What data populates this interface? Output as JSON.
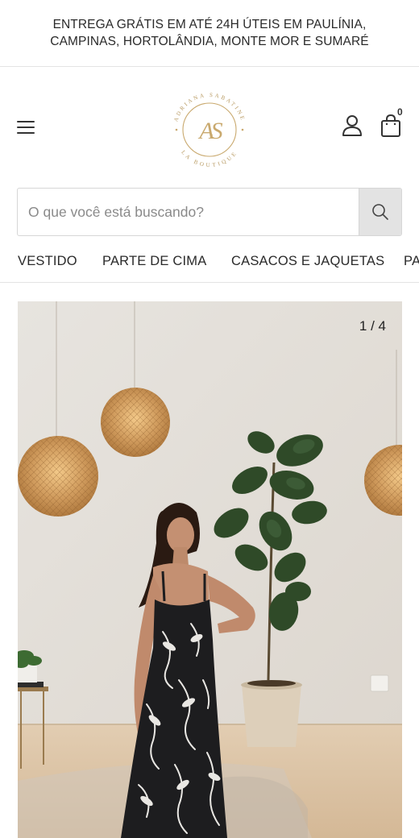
{
  "announcement": {
    "line1": "ENTREGA GRÁTIS EM ATÉ 24H ÚTEIS EM PAULÍNIA,",
    "line2": "CAMPINAS, HORTOLÂNDIA, MONTE MOR E SUMARÉ"
  },
  "header": {
    "menu_icon": "hamburger-menu-icon",
    "logo": {
      "monogram": "AS",
      "arc_top": "ADRIANA SABATINE",
      "arc_bottom": "LA BOUTIQUE",
      "color": "#c9a96e"
    },
    "account_icon": "user-icon",
    "cart_icon": "shopping-bag-icon",
    "cart_count": "0"
  },
  "search": {
    "placeholder": "O que você está buscando?",
    "value": "",
    "icon": "search-icon"
  },
  "nav": {
    "categories": [
      "VESTIDO",
      "PARTE DE CIMA",
      "CASACOS E JAQUETAS",
      "PA"
    ]
  },
  "gallery": {
    "counter": "1 / 4",
    "alt": "Modelo usando vestido longo preto com estampa floral branca"
  },
  "colors": {
    "text": "#2b2b2b",
    "border": "#d6d6d6",
    "search_button_bg": "#e3e3e3",
    "logo_gold": "#c9a96e"
  }
}
